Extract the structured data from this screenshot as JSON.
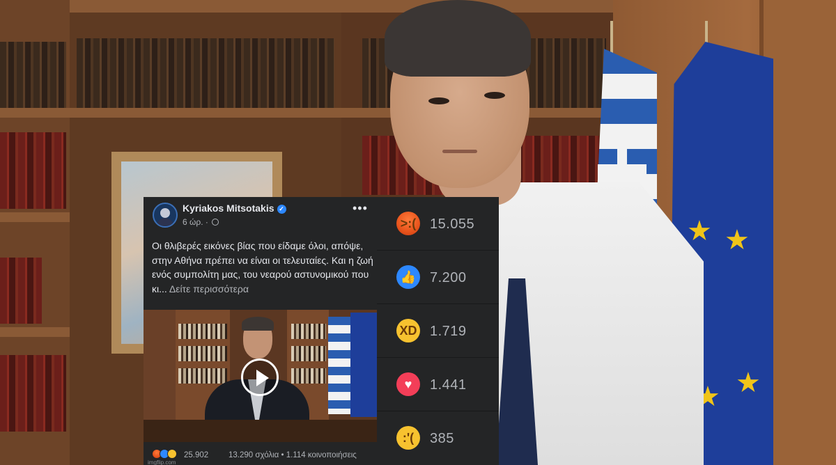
{
  "post": {
    "author": "Kyriakos Mitsotakis",
    "time": "6 ώρ. ·",
    "text": "Οι θλιβερές εικόνες βίας που είδαμε όλοι, απόψε, στην Αθήνα πρέπει να είναι οι τελευταίες. Και η ζωή ενός συμπολίτη μας, του νεαρού αστυνομικού που κι...",
    "see_more": "Δείτε περισσότερα",
    "reaction_total": "25.902",
    "stats": "13.290 σχόλια • 1.114 κοινοποιήσεις",
    "watermark": "imgflip.com"
  },
  "reactions": [
    {
      "type": "angry",
      "icon": "angry-emoji-icon",
      "count": "15.055",
      "color": "#e8541c"
    },
    {
      "type": "like",
      "icon": "like-thumb-icon",
      "count": "7.200",
      "color": "#2d88ff"
    },
    {
      "type": "haha",
      "icon": "haha-emoji-icon",
      "count": "1.719",
      "color": "#f7c22f"
    },
    {
      "type": "love",
      "icon": "heart-icon",
      "count": "1.441",
      "color": "#f33e58"
    },
    {
      "type": "sad",
      "icon": "sad-emoji-icon",
      "count": "385",
      "color": "#f7c22f"
    }
  ]
}
